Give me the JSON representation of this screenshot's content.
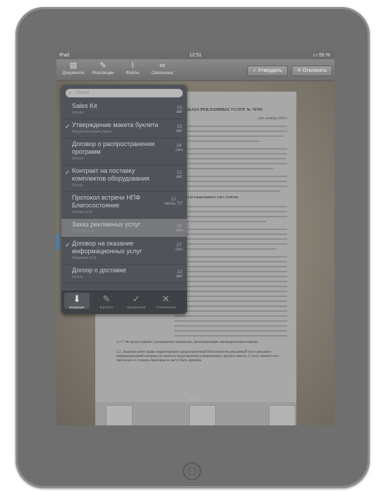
{
  "status": {
    "carrier": "iPad",
    "time": "12:51",
    "battery": "55 %"
  },
  "toolbar": {
    "tabs": [
      {
        "label": "Документы",
        "icon": "documents-icon"
      },
      {
        "label": "Резолюции",
        "icon": "pen-icon"
      },
      {
        "label": "Файлы",
        "icon": "paperclip-icon"
      },
      {
        "label": "Связанные",
        "icon": "link-icon"
      }
    ],
    "approve_label": "Утвердить",
    "reject_label": "Отклонить"
  },
  "popover": {
    "search_placeholder": "Поиск",
    "items": [
      {
        "title": "Sales Kit",
        "subtitle": "Oracle",
        "day": "13",
        "month": "авг",
        "checked": false,
        "selected": false
      },
      {
        "title": "Утверждение макета буклета",
        "subtitle": "Маркетинговый отдел",
        "day": "22",
        "month": "авг",
        "checked": true,
        "selected": false
      },
      {
        "title": "Договор о распространении программ",
        "subtitle": "Oracle",
        "day": "28",
        "month": "сен",
        "checked": false,
        "selected": false
      },
      {
        "title": "Контракт на поставку комплектов оборудования",
        "subtitle": "Oracle",
        "day": "21",
        "month": "авг",
        "checked": true,
        "selected": false
      },
      {
        "title": "Протокол встречи НПФ Благосостояние",
        "subtitle": "Кокора Е.В.",
        "day": "12",
        "month": "июль '07",
        "checked": false,
        "selected": false
      },
      {
        "title": "Заказ рекламных услуг",
        "subtitle": "Сухолуз А.Н.",
        "day": "30",
        "month": "сен",
        "checked": false,
        "selected": true
      },
      {
        "title": "Договор на оказание информационных услуг",
        "subtitle": "Абрамов М.А.",
        "day": "27",
        "month": "сен",
        "checked": true,
        "selected": false
      },
      {
        "title": "Догоор о доставке",
        "subtitle": "Oracle",
        "day": "13",
        "month": "авг",
        "checked": false,
        "selected": false
      }
    ],
    "tabs": [
      {
        "label": "Входящие",
        "icon": "inbox-icon",
        "active": true
      },
      {
        "label": "В работе",
        "icon": "pen-icon",
        "active": false
      },
      {
        "label": "Одобренные",
        "icon": "checkmark-icon",
        "active": false
      },
      {
        "label": "Отклоненные",
        "icon": "close-icon",
        "active": false
      }
    ]
  },
  "document": {
    "title": "ДОГОВОР ЗАКАЗА РЕКЛАМНЫХ УСЛУГ № 76765",
    "date": "«30» октября 2009 г.",
    "section": "2. ПРАВА И ОБЯЗАННОСТИ СТОРОН",
    "clause_a": "2.1.7. Не предоставлять к размещению материалы, противоречащие законодательным нормам.",
    "clause_b": "2.2. Заказчик имеет право корректировать предоставленный Исполнителем рекламный текст рекламно-информационный материал до момента представления утвержденного проекта макета. С этого момента все претензии со стороны Заказчика не могут быть приняты."
  },
  "pages": [
    "1",
    "2",
    "3"
  ]
}
